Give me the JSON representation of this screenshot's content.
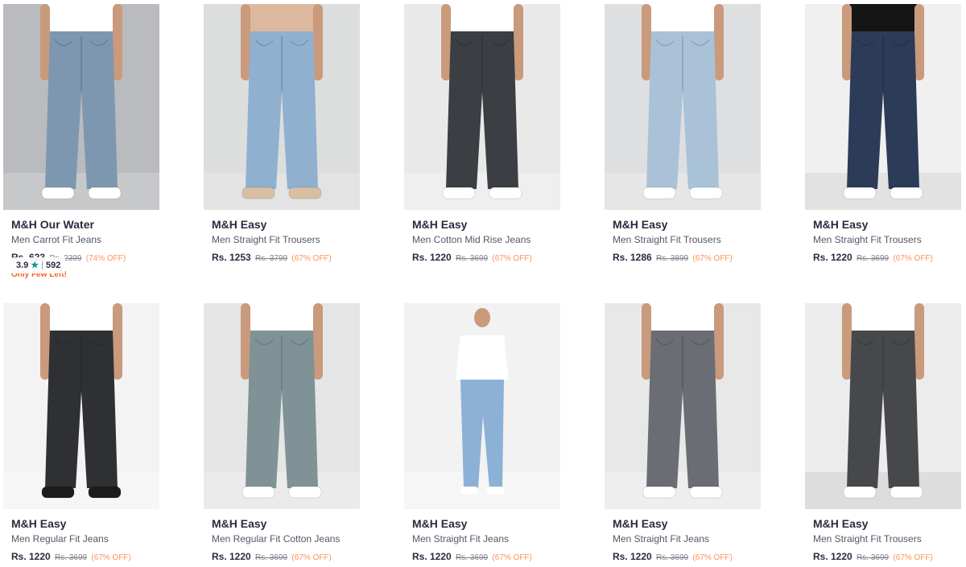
{
  "products": [
    {
      "brand": "M&H Our Water",
      "name": "Men Carrot Fit Jeans",
      "price": "Rs. 623",
      "mrp": "Rs. 2399",
      "discount": "(74% OFF)",
      "badge": "Only Few Left!",
      "rating": "3.9",
      "rating_count": "592",
      "bg": "#b9bbbe",
      "floor": "#c6c8ca",
      "shirt": "#ffffff",
      "jeans": "#7d97b0",
      "shoes": "#ffffff"
    },
    {
      "brand": "M&H Easy",
      "name": "Men Straight Fit Trousers",
      "price": "Rs. 1253",
      "mrp": "Rs. 3799",
      "discount": "(67% OFF)",
      "bg": "#dcdddd",
      "floor": "#e3e3e3",
      "shirt": "#dcb89e",
      "jeans": "#8fb0cf",
      "shoes": "#d9bfa2"
    },
    {
      "brand": "M&H Easy",
      "name": "Men Cotton Mid Rise Jeans",
      "price": "Rs. 1220",
      "mrp": "Rs. 3699",
      "discount": "(67% OFF)",
      "bg": "#e9e9ea",
      "floor": "#efefef",
      "shirt": "#ffffff",
      "jeans": "#3b3e43",
      "shoes": "#ffffff"
    },
    {
      "brand": "M&H Easy",
      "name": "Men Straight Fit Trousers",
      "price": "Rs. 1286",
      "mrp": "Rs. 3899",
      "discount": "(67% OFF)",
      "bg": "#dedfe0",
      "floor": "#e6e6e6",
      "shirt": "#ffffff",
      "jeans": "#a9c2d8",
      "shoes": "#ffffff"
    },
    {
      "brand": "M&H Easy",
      "name": "Men Straight Fit Trousers",
      "price": "Rs. 1220",
      "mrp": "Rs. 3699",
      "discount": "(67% OFF)",
      "bg": "#f0f0f1",
      "floor": "#e2e2e3",
      "shirt": "#151515",
      "jeans": "#2c3b57",
      "shoes": "#ffffff"
    },
    {
      "brand": "M&H Easy",
      "name": "Men Regular Fit Jeans",
      "price": "Rs. 1220",
      "mrp": "Rs. 3699",
      "discount": "(67% OFF)",
      "bg": "#f3f3f3",
      "floor": "#f6f6f6",
      "shirt": "#ffffff",
      "jeans": "#2e3034",
      "shoes": "#1c1c1c"
    },
    {
      "brand": "M&H Easy",
      "name": "Men Regular Fit Cotton Jeans",
      "price": "Rs. 1220",
      "mrp": "Rs. 3699",
      "discount": "(67% OFF)",
      "bg": "#e5e5e6",
      "floor": "#ebebeb",
      "shirt": "#ffffff",
      "jeans": "#7f9296",
      "shoes": "#ffffff"
    },
    {
      "brand": "M&H Easy",
      "name": "Men Straight Fit Jeans",
      "price": "Rs. 1220",
      "mrp": "Rs. 3699",
      "discount": "(67% OFF)",
      "bg": "#f2f2f2",
      "floor": "#f6f6f6",
      "shirt": "#ffffff",
      "jeans": "#8db0d6",
      "shoes": "#ffffff"
    },
    {
      "brand": "M&H Easy",
      "name": "Men Straight Fit Jeans",
      "price": "Rs. 1220",
      "mrp": "Rs. 3699",
      "discount": "(67% OFF)",
      "bg": "#e8e8e8",
      "floor": "#eeeeee",
      "shirt": "#ffffff",
      "jeans": "#6a6d73",
      "shoes": "#ffffff"
    },
    {
      "brand": "M&H Easy",
      "name": "Men Straight Fit Trousers",
      "price": "Rs. 1220",
      "mrp": "Rs. 3699",
      "discount": "(67% OFF)",
      "bg": "#ececec",
      "floor": "#dddddd",
      "shirt": "#ffffff",
      "jeans": "#46484c",
      "shoes": "#ffffff"
    }
  ],
  "icons": {
    "rating_star": "star-icon"
  }
}
